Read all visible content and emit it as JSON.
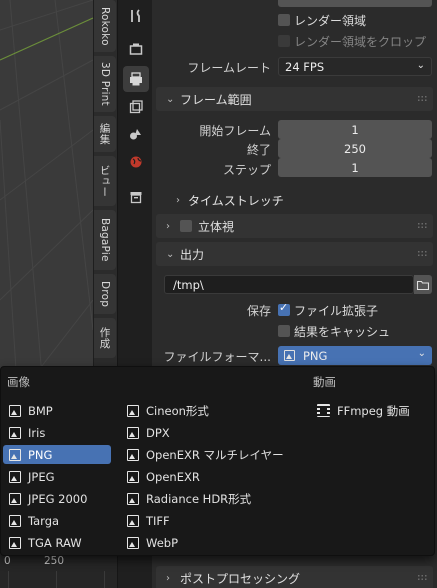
{
  "sidebar_tabs": [
    "Rokoko",
    "3D Print",
    "編集",
    "ビュー",
    "BagaPie",
    "Drop",
    "作成"
  ],
  "timeline": {
    "labels": [
      "0",
      "250"
    ]
  },
  "property_icons": [
    "tool-icon",
    "render-icon",
    "output-icon",
    "view-layer-icon",
    "scene-icon",
    "world-icon",
    "collection-icon"
  ],
  "render_region": {
    "region_label": "レンダー領域",
    "crop_label": "レンダー領域をクロップ",
    "framerate_label": "フレームレート",
    "framerate_value": "24 FPS"
  },
  "frame_range": {
    "title": "フレーム範囲",
    "start_label": "開始フレーム",
    "start_value": "1",
    "end_label": "終了",
    "end_value": "250",
    "step_label": "ステップ",
    "step_value": "1",
    "time_stretch_label": "タイムストレッチ"
  },
  "stereoscopy": {
    "title": "立体視"
  },
  "output": {
    "title": "出力",
    "path": "/tmp\\",
    "save_label": "保存",
    "file_ext_label": "ファイル拡張子",
    "cache_label": "結果をキャッシュ",
    "format_label": "ファイルフォーマ...",
    "format_value": "PNG"
  },
  "post_processing": {
    "title": "ポストプロセッシング"
  },
  "dropdown": {
    "image_header": "画像",
    "movie_header": "動画",
    "col1": [
      "BMP",
      "Iris",
      "PNG",
      "JPEG",
      "JPEG 2000",
      "Targa",
      "TGA RAW"
    ],
    "col2": [
      "Cineon形式",
      "DPX",
      "OpenEXR マルチレイヤー",
      "OpenEXR",
      "Radiance HDR形式",
      "TIFF",
      "WebP"
    ],
    "col3": [
      "FFmpeg 動画"
    ],
    "selected": "PNG"
  },
  "colors": {
    "accent": "#4772b3",
    "panel": "#2b2b2b",
    "menu": "#181818"
  }
}
